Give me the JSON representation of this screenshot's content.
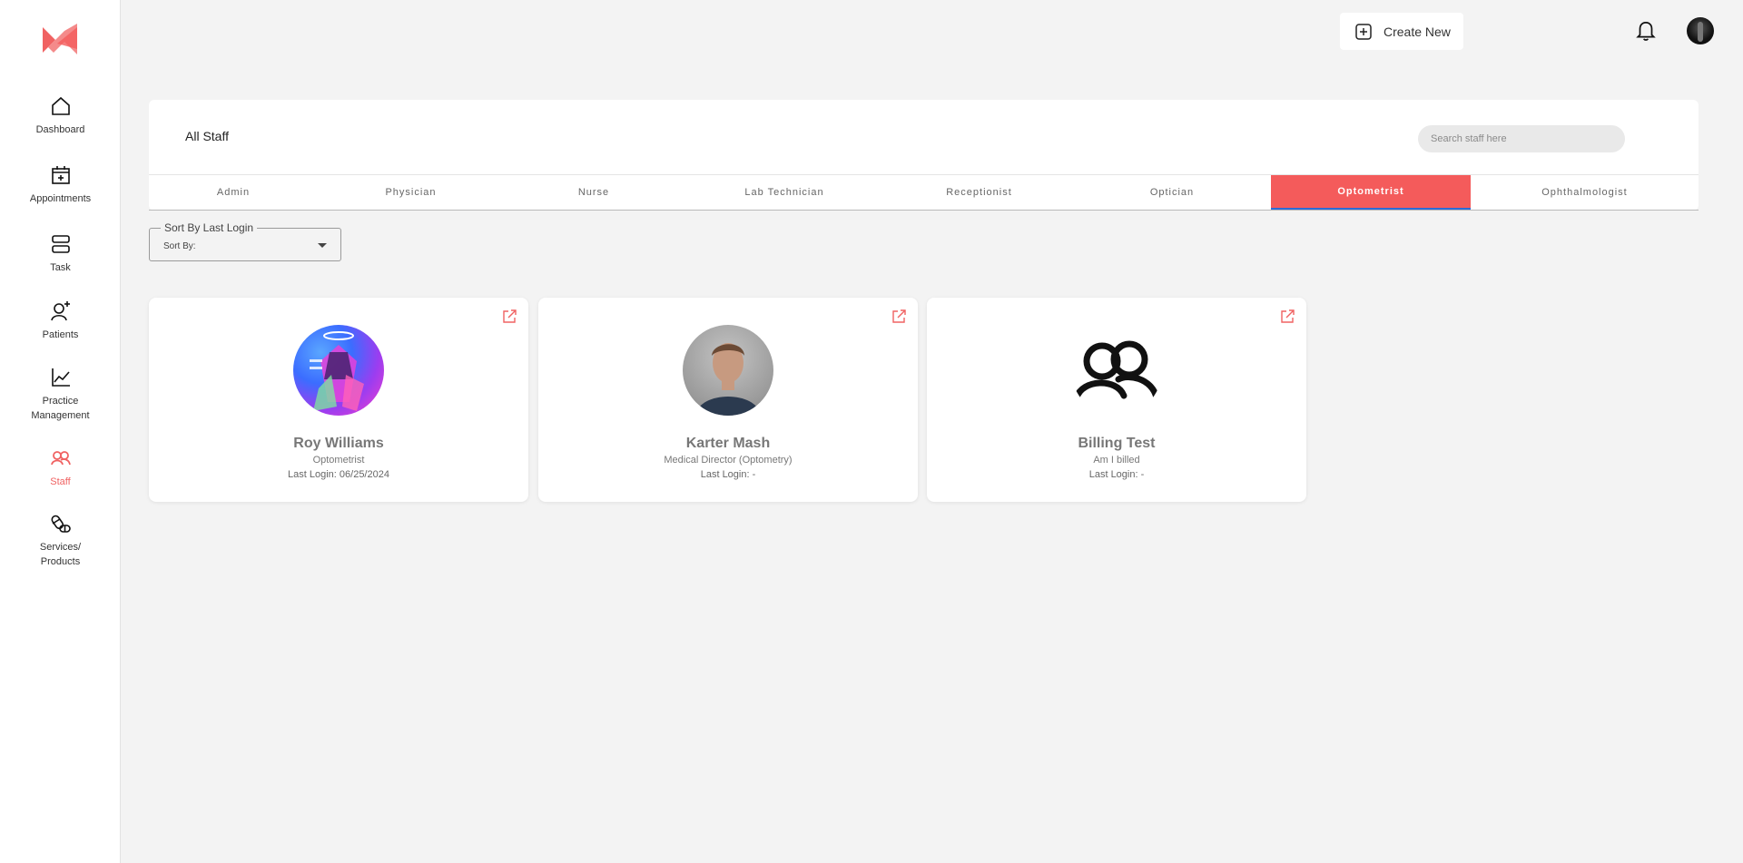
{
  "brand": {
    "accent": "#f45b5b",
    "logo_icon": "brand-logo-icon"
  },
  "sidebar": {
    "items": [
      {
        "label": "Dashboard",
        "icon": "home-icon"
      },
      {
        "label": "Appointments",
        "icon": "calendar-plus-icon"
      },
      {
        "label": "Task",
        "icon": "task-icon"
      },
      {
        "label": "Patients",
        "icon": "user-plus-icon"
      },
      {
        "label": "Practice Management",
        "icon": "chart-line-icon"
      },
      {
        "label": "Staff",
        "icon": "users-icon",
        "active": true
      },
      {
        "label": "Services/ Products",
        "icon": "pills-icon"
      }
    ]
  },
  "topbar": {
    "create_label": "Create New",
    "create_icon": "plus-square-icon",
    "bell_icon": "bell-icon"
  },
  "panel": {
    "title": "All Staff",
    "search_placeholder": "Search staff here",
    "tabs": [
      {
        "label": "Admin"
      },
      {
        "label": "Physician"
      },
      {
        "label": "Nurse"
      },
      {
        "label": "Lab Technician"
      },
      {
        "label": "Receptionist"
      },
      {
        "label": "Optician"
      },
      {
        "label": "Optometrist",
        "active": true
      },
      {
        "label": "Ophthalmologist"
      }
    ]
  },
  "sort": {
    "legend": "Sort By Last Login",
    "value": "Sort By:"
  },
  "cards": [
    {
      "name": "Roy Williams",
      "role": "Optometrist",
      "login": "Last Login: 06/25/2024"
    },
    {
      "name": "Karter Mash",
      "role": "Medical Director (Optometry)",
      "login": "Last Login: -"
    },
    {
      "name": "Billing Test",
      "role": "Am I billed",
      "login": "Last Login: -"
    }
  ]
}
